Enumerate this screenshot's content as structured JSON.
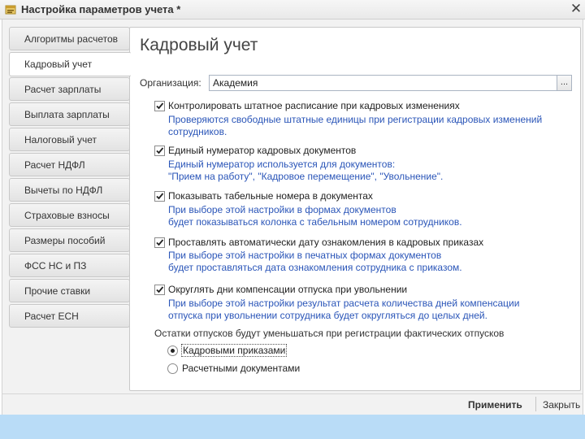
{
  "window": {
    "title": "Настройка параметров учета *",
    "close_glyph": "✕"
  },
  "tabs": [
    {
      "label": "Алгоритмы расчетов",
      "active": false
    },
    {
      "label": "Кадровый учет",
      "active": true
    },
    {
      "label": "Расчет зарплаты",
      "active": false
    },
    {
      "label": "Выплата зарплаты",
      "active": false
    },
    {
      "label": "Налоговый учет",
      "active": false
    },
    {
      "label": "Расчет НДФЛ",
      "active": false
    },
    {
      "label": "Вычеты по НДФЛ",
      "active": false
    },
    {
      "label": "Страховые взносы",
      "active": false
    },
    {
      "label": "Размеры пособий",
      "active": false
    },
    {
      "label": "ФСС НС и ПЗ",
      "active": false
    },
    {
      "label": "Прочие ставки",
      "active": false
    },
    {
      "label": "Расчет ЕСН",
      "active": false
    }
  ],
  "main": {
    "heading": "Кадровый учет",
    "organization": {
      "label": "Организация:",
      "value": "Академия",
      "select_button": "..."
    },
    "options": [
      {
        "label": "Контролировать штатное расписание при кадровых изменениях",
        "checked": true,
        "hint": [
          "Проверяются свободные штатные единицы при регистрации кадровых изменений",
          "сотрудников."
        ]
      },
      {
        "label": "Единый нумератор кадровых документов",
        "checked": true,
        "hint": [
          "Единый нумератор используется для документов:",
          "\"Прием на работу\", \"Кадровое перемещение\", \"Увольнение\"."
        ]
      },
      {
        "label": "Показывать табельные номера в документах",
        "checked": true,
        "hint": [
          "При выборе этой настройки в формах документов",
          "будет показываться колонка с табельным номером сотрудников."
        ]
      },
      {
        "label": "Проставлять автоматически дату ознакомления в кадровых приказах",
        "checked": true,
        "hint": [
          "При выборе этой настройки в печатных формах документов",
          "будет проставляться дата ознакомления сотрудника с приказом."
        ]
      },
      {
        "label": "Округлять дни компенсации отпуска при увольнении",
        "checked": true,
        "hint": [
          "При выборе этой настройки результат расчета количества дней компенсации",
          "отпуска при увольнении сотрудника будет округляться до целых дней."
        ]
      }
    ],
    "vacation_balance": {
      "label": "Остатки отпусков будут уменьшаться при регистрации фактических отпусков",
      "choices": [
        {
          "label": "Кадровыми приказами",
          "selected": true
        },
        {
          "label": "Расчетными документами",
          "selected": false
        }
      ]
    }
  },
  "actions": {
    "apply": "Применить",
    "close": "Закрыть"
  },
  "colors": {
    "hint_text": "#2a55b8",
    "footer_band": "#b9dcf7",
    "panel_bg": "#f2f2f2"
  }
}
